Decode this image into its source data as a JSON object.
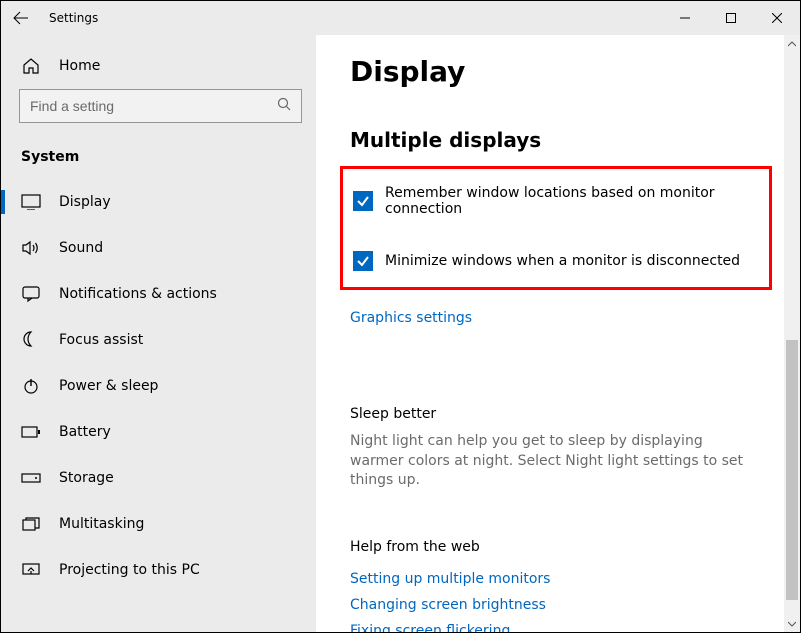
{
  "titlebar": {
    "title": "Settings"
  },
  "sidebar": {
    "home_label": "Home",
    "search_placeholder": "Find a setting",
    "section_label": "System",
    "items": [
      {
        "label": "Display"
      },
      {
        "label": "Sound"
      },
      {
        "label": "Notifications & actions"
      },
      {
        "label": "Focus assist"
      },
      {
        "label": "Power & sleep"
      },
      {
        "label": "Battery"
      },
      {
        "label": "Storage"
      },
      {
        "label": "Multitasking"
      },
      {
        "label": "Projecting to this PC"
      }
    ]
  },
  "main": {
    "page_title": "Display",
    "multiple_displays": {
      "title": "Multiple displays",
      "checkbox1": "Remember window locations based on monitor connection",
      "checkbox2": "Minimize windows when a monitor is disconnected",
      "graphics_link": "Graphics settings"
    },
    "sleep": {
      "title": "Sleep better",
      "desc": "Night light can help you get to sleep by displaying warmer colors at night. Select Night light settings to set things up."
    },
    "help": {
      "title": "Help from the web",
      "links": [
        "Setting up multiple monitors",
        "Changing screen brightness",
        "Fixing screen flickering"
      ]
    }
  }
}
